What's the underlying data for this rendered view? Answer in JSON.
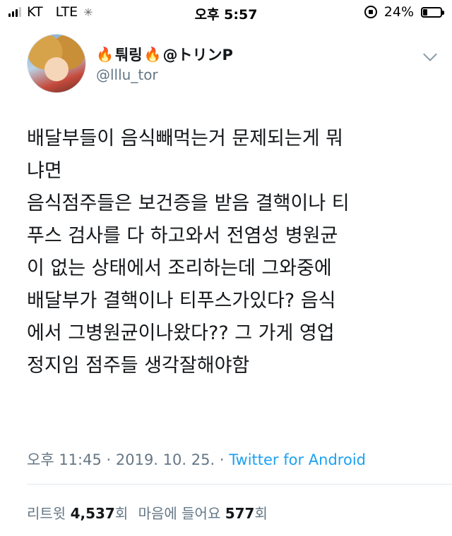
{
  "status_bar": {
    "carrier": "KT",
    "network": "LTE",
    "time": "오후 5:57",
    "battery_percent_label": "24%",
    "battery_level": 0.24
  },
  "tweet": {
    "display_name_text": "퉈링",
    "display_name_suffix": "@トリンP",
    "handle": "@lllu_tor",
    "text_lines": [
      "배달부들이 음식빼먹는거 문제되는게 뭐",
      "냐면",
      "음식점주들은 보건증을 받음 결핵이나 티",
      "푸스 검사를 다 하고와서 전염성 병원균",
      "이 없는 상태에서 조리하는데 그와중에",
      "배달부가 결핵이나 티푸스가있다? 음식",
      "에서 그병원균이나왔다?? 그 가게 영업",
      "정지임 점주들 생각잘해야함"
    ],
    "timestamp": "오후 11:45 · 2019. 10. 25.",
    "separator": "·",
    "source": "Twitter for Android",
    "retweets_label": "리트윗",
    "retweets_count": "4,537",
    "retweets_unit": "회",
    "likes_label": "마음에 들어요",
    "likes_count": "577",
    "likes_unit": "회"
  },
  "icons": {
    "fire": "fire-icon",
    "caret": "chevron-down-icon"
  },
  "colors": {
    "accent": "#1da1f2",
    "secondary_text": "#657786",
    "primary_text": "#14171a"
  }
}
